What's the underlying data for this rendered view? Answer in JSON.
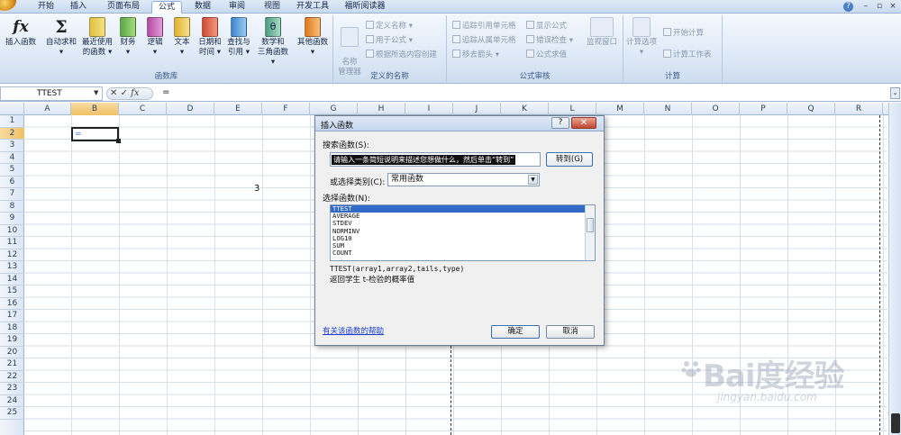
{
  "tabs": [
    "开始",
    "插入",
    "页面布局",
    "公式",
    "数据",
    "审阅",
    "视图",
    "开发工具",
    "福昕阅读器"
  ],
  "active_tab": "公式",
  "window_controls": [
    "?",
    "–",
    "▫",
    "×"
  ],
  "ribbon": {
    "function_library": {
      "label": "函数库",
      "buttons": [
        {
          "label": "插入函数",
          "sub": ""
        },
        {
          "label": "自动求和",
          "sub": "▾"
        },
        {
          "label": "最近使用",
          "sub": "的函数 ▾"
        },
        {
          "label": "财务",
          "sub": "▾"
        },
        {
          "label": "逻辑",
          "sub": "▾"
        },
        {
          "label": "文本",
          "sub": "▾"
        },
        {
          "label": "日期和",
          "sub": "时间 ▾"
        },
        {
          "label": "查找与",
          "sub": "引用 ▾"
        },
        {
          "label": "数学和",
          "sub": "三角函数 ▾"
        },
        {
          "label": "其他函数",
          "sub": "▾"
        }
      ]
    },
    "defined_names": {
      "label": "定义的名称",
      "manager": "名称\n管理器",
      "define": "定义名称 ▾",
      "use": "用于公式 ▾",
      "create": "根据所选内容创建"
    },
    "formula_auditing": {
      "label": "公式审核",
      "trace_prec": "追踪引用单元格",
      "trace_dep": "追踪从属单元格",
      "remove_arrows": "移去箭头 ▾",
      "show_formulas": "显示公式",
      "error_check": "错误检查 ▾",
      "evaluate": "公式求值",
      "watch": "监视窗口"
    },
    "calculation": {
      "label": "计算",
      "options": "计算选项",
      "options_sub": "▾",
      "calc_now": "开始计算",
      "calc_sheet": "计算工作表"
    }
  },
  "formula_bar": {
    "name_box": "TTEST",
    "fx": "fx",
    "content": "="
  },
  "columns": [
    "A",
    "B",
    "C",
    "D",
    "E",
    "F",
    "G",
    "H",
    "I",
    "J",
    "K",
    "L",
    "M",
    "N",
    "O",
    "P",
    "Q",
    "R"
  ],
  "rows": [
    "1",
    "2",
    "3",
    "4",
    "5",
    "6",
    "7",
    "8",
    "9",
    "10",
    "11",
    "12",
    "13",
    "14",
    "15",
    "16",
    "17",
    "18",
    "19",
    "20",
    "21",
    "22",
    "23",
    "24",
    "25"
  ],
  "cells": {
    "B2": "=",
    "E6": "3"
  },
  "dialog": {
    "title": "插入函数",
    "search_label": "搜索函数(S):",
    "search_value": "请输入一条简短说明来描述您想做什么，然后单击“转到”",
    "go_button": "转到(G)",
    "category_label": "或选择类别(C):",
    "category_value": "常用函数",
    "select_label": "选择函数(N):",
    "functions": [
      "TTEST",
      "AVERAGE",
      "STDEV",
      "NORMINV",
      "LOG10",
      "SUM",
      "COUNT"
    ],
    "selected_function": "TTEST",
    "signature": "TTEST(array1,array2,tails,type)",
    "description": "返回学生 t-检验的概率值",
    "help_link": "有关该函数的帮助",
    "ok_button": "确定",
    "cancel_button": "取消"
  },
  "watermark": {
    "logo": "Bai度经验",
    "url": "jingyan.baidu.com"
  }
}
